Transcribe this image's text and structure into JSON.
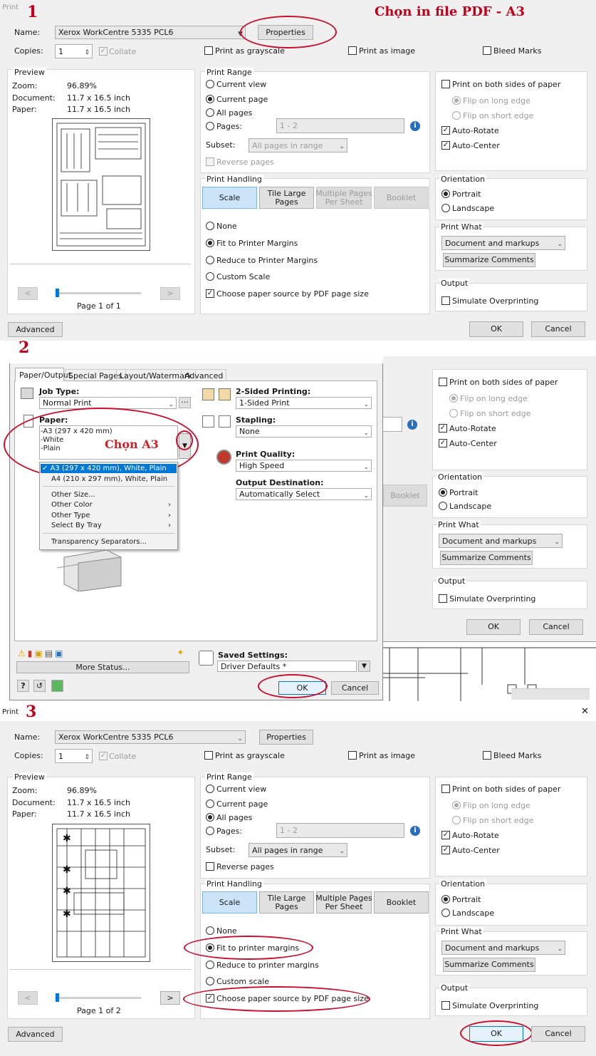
{
  "dialog1": {
    "step": "1",
    "title": "Print",
    "heading": "Chọn in file PDF - A3",
    "name_label": "Name:",
    "printer": "Xerox WorkCentre 5335 PCL6",
    "properties": "Properties",
    "copies_label": "Copies:",
    "copies": "1",
    "collate": "Collate",
    "grayscale": "Print as grayscale",
    "as_image": "Print as image",
    "bleed": "Bleed Marks",
    "preview_title": "Preview",
    "zoom_label": "Zoom:",
    "zoom": "96.89%",
    "document_label": "Document:",
    "document": "11.7 x 16.5 inch",
    "paper_label": "Paper:",
    "paper": "11.7 x 16.5 inch",
    "prev": "<",
    "next": ">",
    "page_label": "Page 1 of 1",
    "range_title": "Print Range",
    "current_view": "Current view",
    "current_page": "Current page",
    "all_pages": "All pages",
    "pages": "Pages:",
    "pages_value": "1 - 2",
    "subset": "Subset:",
    "subset_value": "All pages in range",
    "reverse": "Reverse pages",
    "handling_title": "Print Handling",
    "scale": "Scale",
    "tile": "Tile Large\nPages",
    "multiple": "Multiple Pages\nPer Sheet",
    "booklet": "Booklet",
    "none": "None",
    "fit": "Fit to Printer Margins",
    "reduce": "Reduce to Printer Margins",
    "custom": "Custom Scale",
    "paper_source": "Choose paper source by PDF page size",
    "both_sides": "Print on both sides of paper",
    "flip_long": "Flip on long edge",
    "flip_short": "Flip on short edge",
    "auto_rotate": "Auto-Rotate",
    "auto_center": "Auto-Center",
    "orientation_title": "Orientation",
    "portrait": "Portrait",
    "landscape": "Landscape",
    "what_title": "Print What",
    "what_value": "Document and markups",
    "summarize": "Summarize Comments",
    "output_title": "Output",
    "overprint": "Simulate Overprinting",
    "advanced": "Advanced",
    "ok": "OK",
    "cancel": "Cancel"
  },
  "dialog2": {
    "step": "2",
    "tabs": [
      "Paper/Output",
      "Special Pages",
      "Layout/Watermark",
      "Advanced"
    ],
    "job_type_label": "Job Type:",
    "job_type": "Normal Print",
    "paper_label": "Paper:",
    "paper_lines": [
      "-A3 (297 x 420 mm)",
      "-White",
      "-Plain"
    ],
    "annotation": "Chọn A3",
    "menu_sel": "A3 (297 x 420 mm), White, Plain",
    "menu_a4": "A4 (210 x 297 mm), White, Plain",
    "menu_items": [
      "Other Size...",
      "Other Color",
      "Other Type",
      "Select By Tray",
      "Transparency Separators..."
    ],
    "two_sided_label": "2-Sided Printing:",
    "two_sided": "1-Sided Print",
    "stapling_label": "Stapling:",
    "stapling": "None",
    "quality_label": "Print Quality:",
    "quality": "High Speed",
    "destination_label": "Output Destination:",
    "destination": "Automatically Select",
    "more_status": "More Status...",
    "saved_label": "Saved Settings:",
    "saved": "Driver Defaults *",
    "help": "?",
    "ok": "OK",
    "cancel": "Cancel",
    "bg": {
      "both_sides": "Print on both sides of paper",
      "flip_long": "Flip on long edge",
      "flip_short": "Flip on short edge",
      "auto_rotate": "Auto-Rotate",
      "auto_center": "Auto-Center",
      "orientation_title": "Orientation",
      "portrait": "Portrait",
      "landscape": "Landscape",
      "what_title": "Print What",
      "what_value": "Document and markups",
      "summarize": "Summarize Comments",
      "output_title": "Output",
      "overprint": "Simulate Overprinting",
      "booklet": "Booklet",
      "ok": "OK",
      "cancel": "Cancel"
    }
  },
  "dialog3": {
    "step": "3",
    "title": "Print",
    "close": "✕",
    "name_label": "Name:",
    "printer": "Xerox WorkCentre 5335 PCL6",
    "properties": "Properties",
    "copies_label": "Copies:",
    "copies": "1",
    "collate": "Collate",
    "grayscale": "Print as grayscale",
    "as_image": "Print as image",
    "bleed": "Bleed Marks",
    "preview_title": "Preview",
    "zoom_label": "Zoom:",
    "zoom": "96.89%",
    "document_label": "Document:",
    "document": "11.7 x 16.5 inch",
    "paper_label": "Paper:",
    "paper": "11.7 x 16.5 inch",
    "prev": "<",
    "next": ">",
    "page_label": "Page 1 of 2",
    "range_title": "Print Range",
    "current_view": "Current view",
    "current_page": "Current page",
    "all_pages": "All pages",
    "pages": "Pages:",
    "pages_value": "1 - 2",
    "subset": "Subset:",
    "subset_value": "All pages in range",
    "reverse": "Reverse pages",
    "handling_title": "Print Handling",
    "scale": "Scale",
    "tile": "Tile Large\nPages",
    "multiple": "Multiple Pages\nPer Sheet",
    "booklet": "Booklet",
    "none": "None",
    "fit": "Fit to printer margins",
    "reduce": "Reduce to printer margins",
    "custom": "Custom scale",
    "paper_source": "Choose paper source by PDF page size",
    "both_sides": "Print on both sides of paper",
    "flip_long": "Flip on long edge",
    "flip_short": "Flip on short edge",
    "auto_rotate": "Auto-Rotate",
    "auto_center": "Auto-Center",
    "orientation_title": "Orientation",
    "portrait": "Portrait",
    "landscape": "Landscape",
    "what_title": "Print What",
    "what_value": "Document and markups",
    "summarize": "Summarize Comments",
    "output_title": "Output",
    "overprint": "Simulate Overprinting",
    "advanced": "Advanced",
    "ok": "OK",
    "cancel": "Cancel"
  },
  "colors": {
    "annotation_red": "#c8102e",
    "selection_blue": "#0078d7",
    "button_selected": "#cce4f7"
  }
}
